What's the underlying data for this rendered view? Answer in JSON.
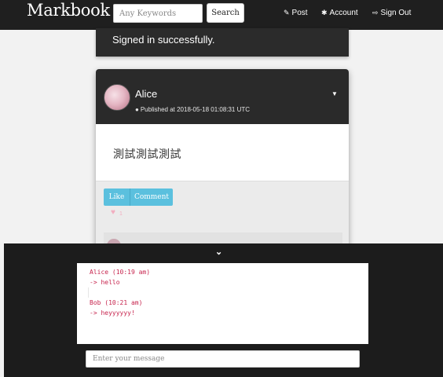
{
  "navbar": {
    "brand": "Markbook",
    "search_placeholder": "Any Keywords",
    "search_label": "Search",
    "links": [
      {
        "icon": "pencil-icon",
        "glyph": "✎",
        "label": "Post"
      },
      {
        "icon": "gear-icon",
        "glyph": "✱",
        "label": "Account"
      },
      {
        "icon": "sign-out-icon",
        "glyph": "⇨",
        "label": "Sign Out"
      }
    ]
  },
  "flash": {
    "message": "Signed in successfully."
  },
  "post": {
    "author": "Alice",
    "published": "Published at 2018-05-18 01:08:31 UTC",
    "body": "測試測試測試",
    "like_label": "Like",
    "comment_label": "Comment",
    "like_count": "1"
  },
  "chat": {
    "lines": [
      "Alice (10:19 am)",
      "-> hello",
      "",
      "Bob (10:21 am)",
      "-> heyyyyyy!"
    ],
    "input_placeholder": "Enter your message"
  },
  "colors": {
    "navbar_bg": "#1f1f1f",
    "card_header_bg": "#2a2a2a",
    "accent_button": "#5bc0de",
    "heart": "#f2aec0",
    "chat_text": "#c7254e",
    "chat_panel_bg": "#1c1c1c"
  }
}
